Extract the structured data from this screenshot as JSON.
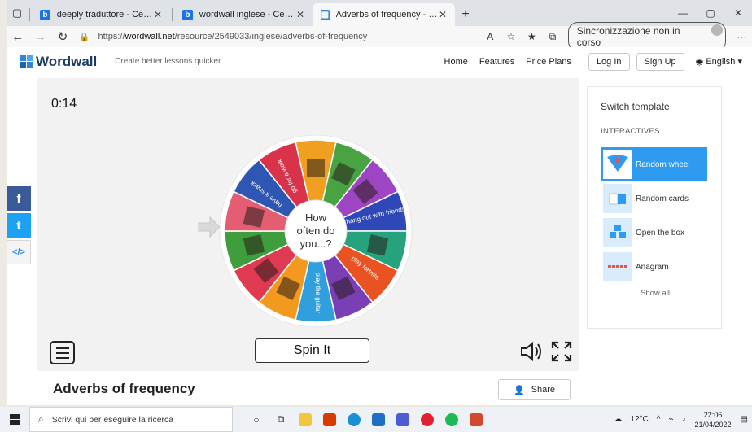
{
  "browser": {
    "tabs": [
      {
        "title": "deeply traduttore - Cerca",
        "favicon": "bing-icon",
        "active": false
      },
      {
        "title": "wordwall inglese - Cerca",
        "favicon": "bing-icon",
        "active": false
      },
      {
        "title": "Adverbs of frequency - Random",
        "favicon": "wordwall-icon",
        "active": true
      }
    ],
    "url_prefix": "https://",
    "url_domain": "wordwall.net",
    "url_path": "/resource/2549033/inglese/adverbs-of-frequency",
    "sync_label": "Sincronizzazione non in corso"
  },
  "header": {
    "brand": "Wordwall",
    "tagline": "Create better lessons quicker",
    "nav": [
      "Home",
      "Features",
      "Price Plans"
    ],
    "login": "Log In",
    "signup": "Sign Up",
    "language": "English"
  },
  "game": {
    "timer": "0:14",
    "center_line1": "How",
    "center_line2": "often do",
    "center_line3": "you...?",
    "spin_label": "Spin It",
    "segments": [
      {
        "label": "",
        "color": "#f0a020"
      },
      {
        "label": "",
        "color": "#4aa342"
      },
      {
        "label": "",
        "color": "#9d45c2"
      },
      {
        "label": "hang out with friends",
        "color": "#2f48b8"
      },
      {
        "label": "",
        "color": "#26a27d"
      },
      {
        "label": "play fortnite",
        "color": "#ea5321"
      },
      {
        "label": "",
        "color": "#7b3fb5"
      },
      {
        "label": "play the guitar",
        "color": "#2fa0dd"
      },
      {
        "label": "",
        "color": "#f39a1e"
      },
      {
        "label": "",
        "color": "#df3a52"
      },
      {
        "label": "",
        "color": "#3f9e3c"
      },
      {
        "label": "",
        "color": "#e35d73"
      },
      {
        "label": "have a snack",
        "color": "#2e57b3"
      },
      {
        "label": "go for a walk",
        "color": "#d8334a"
      }
    ]
  },
  "sidebar": {
    "heading": "Switch template",
    "section": "INTERACTIVES",
    "templates": [
      {
        "label": "Random wheel",
        "selected": true
      },
      {
        "label": "Random cards",
        "selected": false
      },
      {
        "label": "Open the box",
        "selected": false
      },
      {
        "label": "Anagram",
        "selected": false
      }
    ],
    "show_all": "Show all"
  },
  "activity": {
    "title": "Adverbs of frequency",
    "share": "Share"
  },
  "taskbar": {
    "search_placeholder": "Scrivi qui per eseguire la ricerca",
    "weather": "12°C",
    "time": "22:06",
    "date": "21/04/2022"
  }
}
